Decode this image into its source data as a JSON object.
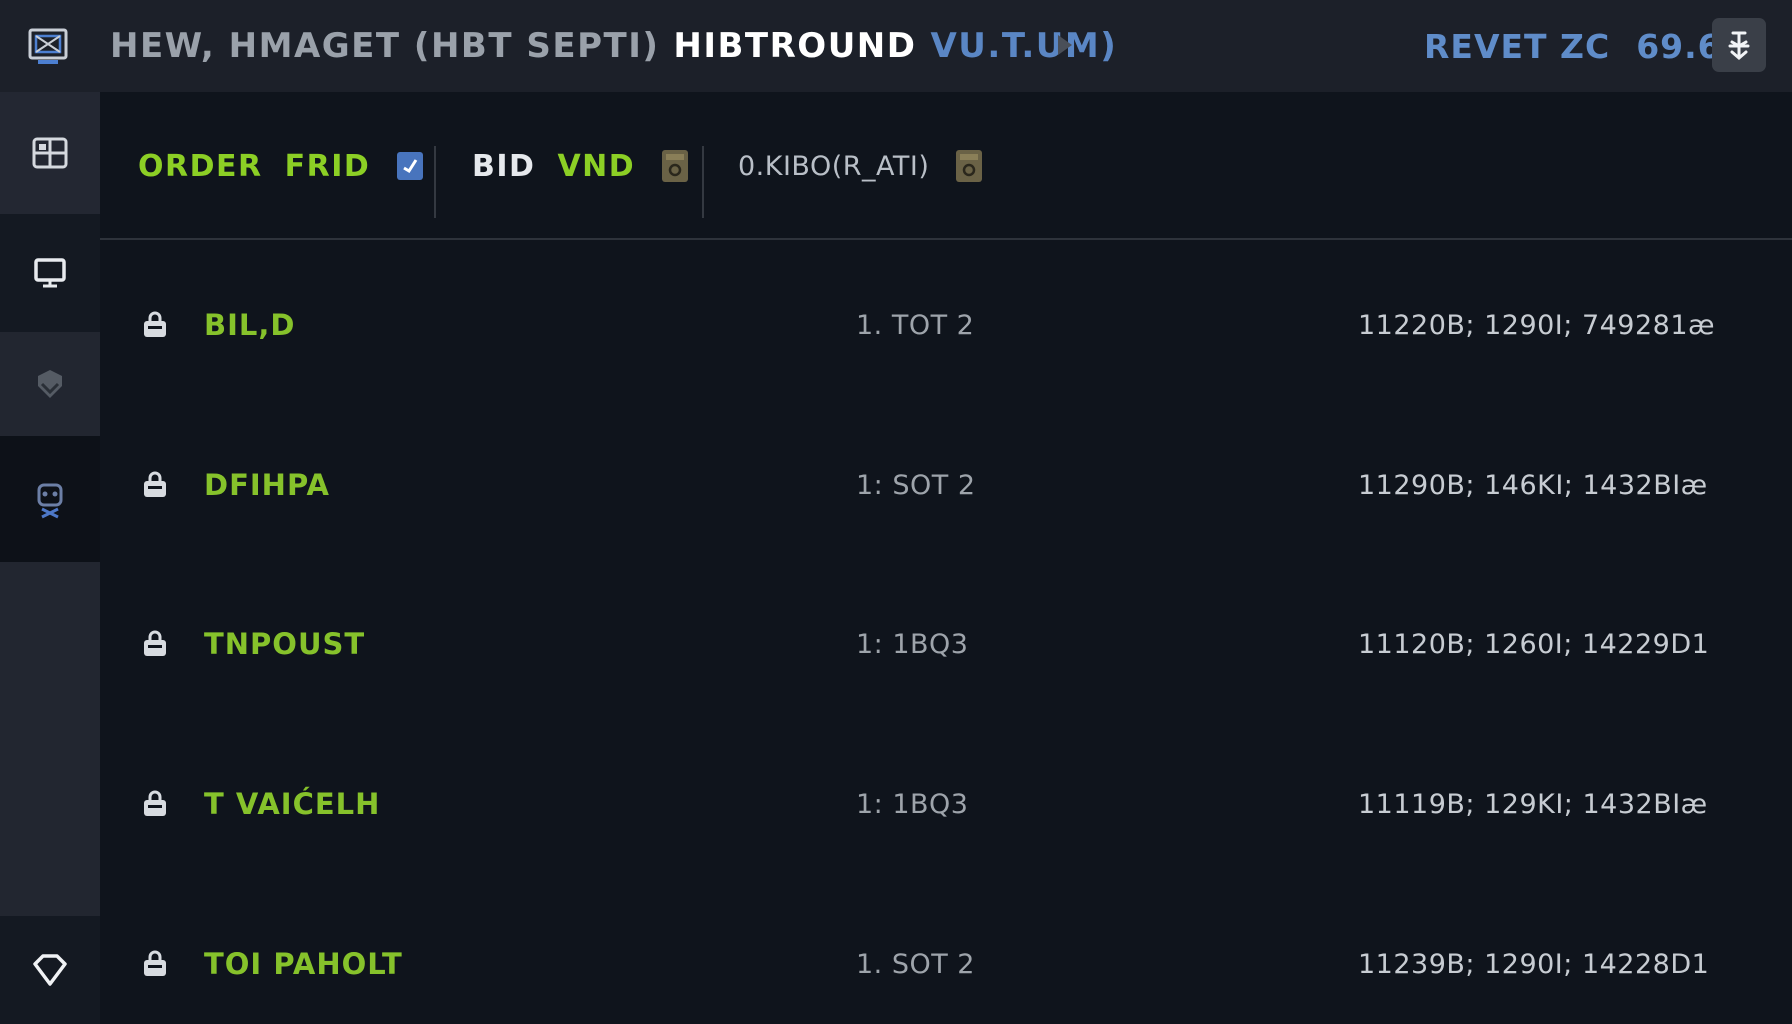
{
  "header": {
    "title_gray": "HEW, HMAGET (HBT SEPTI)",
    "title_white": "HIBTROUND",
    "title_blue": "VU.T.UM)",
    "user_label": "REVET ZC",
    "user_value": "69.6.",
    "icons": {
      "app": "monitor-app-icon",
      "play": "play-icon",
      "pin": "pin-icon"
    }
  },
  "sidebar": {
    "items": [
      {
        "icon": "split-screen-icon"
      },
      {
        "icon": "display-icon"
      },
      {
        "icon": "shield-arrow-icon"
      },
      {
        "icon": "robot-icon",
        "active": true
      },
      {
        "icon": "diamond-icon"
      }
    ]
  },
  "toolbar": {
    "tabs": [
      {
        "label_a": "ORDER",
        "label_b": "FRID",
        "icon": "checkbox-icon"
      },
      {
        "label_a": "BID",
        "label_b": "VND",
        "icon": "lock-badge-icon"
      },
      {
        "label": "0.KIBO(R_ATI)",
        "icon": "lock-badge-icon"
      }
    ]
  },
  "rows": [
    {
      "name": "BIL,D",
      "qty": "1. TOT 2",
      "vals": "11220B;  1290I;  749281æ"
    },
    {
      "name": "DFIHPA",
      "qty": "1: SOT 2",
      "vals": "11290B;  146KI;  1432BIæ"
    },
    {
      "name": "TNPOUST",
      "qty": "1: 1BQ3",
      "vals": "11120B;  1260I;  14229D1"
    },
    {
      "name": "T VAIĆELH",
      "qty": "1: 1BQ3",
      "vals": "11119B;  129KI;  1432BIæ"
    },
    {
      "name": "TOI PAHOLT",
      "qty": "1. SOT 2",
      "vals": "11239B;  1290I;  14228D1"
    }
  ],
  "colors": {
    "accent_green": "#8ccf25",
    "accent_blue": "#5a86c4",
    "background": "#0f141c",
    "header_bg": "#1c2029"
  }
}
